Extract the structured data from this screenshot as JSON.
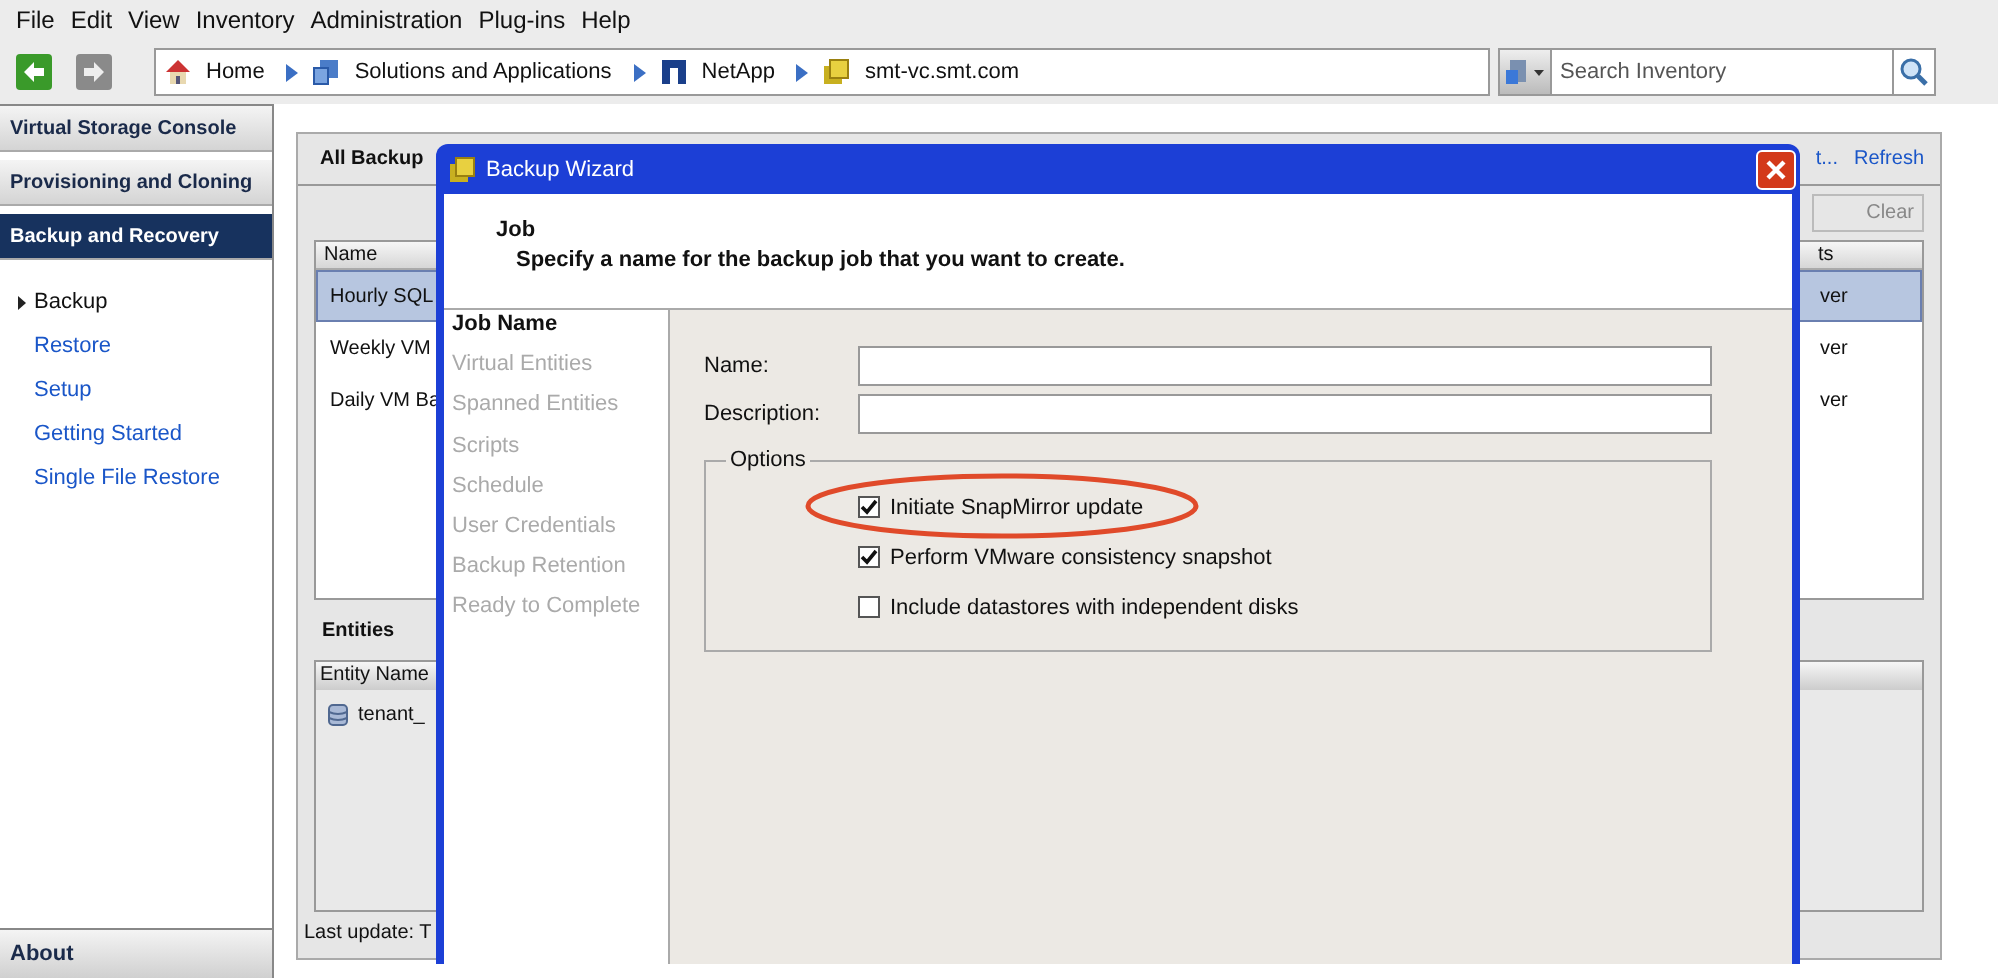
{
  "menu_bar": [
    "File",
    "Edit",
    "View",
    "Inventory",
    "Administration",
    "Plug-ins",
    "Help"
  ],
  "toolbar": {
    "breadcrumbs": [
      {
        "label": "Home"
      },
      {
        "label": "Solutions and Applications"
      },
      {
        "label": "NetApp"
      },
      {
        "label": "smt-vc.smt.com"
      }
    ],
    "search": {
      "placeholder": "Search Inventory"
    }
  },
  "sidebar": {
    "sections": [
      {
        "label": "Virtual Storage Console",
        "selected": false
      },
      {
        "label": "Provisioning and Cloning",
        "selected": false
      },
      {
        "label": "Backup and Recovery",
        "selected": true
      }
    ],
    "items": [
      {
        "label": "Backup",
        "selected": true
      },
      {
        "label": "Restore",
        "selected": false
      },
      {
        "label": "Setup",
        "selected": false
      },
      {
        "label": "Getting Started",
        "selected": false
      },
      {
        "label": "Single File Restore",
        "selected": false
      }
    ],
    "footer": "About"
  },
  "main": {
    "title": "All Backup",
    "links": [
      "t...",
      "Refresh"
    ],
    "clear_button": "Clear",
    "table": {
      "columns": [
        "Name",
        "ts"
      ],
      "rows": [
        {
          "cells": [
            "Hourly SQL",
            "ver"
          ],
          "selected": true
        },
        {
          "cells": [
            "Weekly VM",
            "ver"
          ],
          "selected": false
        },
        {
          "cells": [
            "Daily VM Ba",
            "ver"
          ],
          "selected": false
        }
      ]
    },
    "entities": {
      "title": "Entities",
      "columns": [
        "Entity Name"
      ],
      "rows": [
        "tenant_"
      ]
    },
    "status": "Last update: T"
  },
  "dialog": {
    "title": "Backup Wizard",
    "header_title": "Job",
    "header_subtitle": "Specify a name for the backup job that you want to create.",
    "steps": [
      {
        "label": "Job Name",
        "selected": true
      },
      {
        "label": "Virtual Entities",
        "selected": false
      },
      {
        "label": "Spanned Entities",
        "selected": false
      },
      {
        "label": "Scripts",
        "selected": false
      },
      {
        "label": "Schedule",
        "selected": false
      },
      {
        "label": "User Credentials",
        "selected": false
      },
      {
        "label": "Backup Retention",
        "selected": false
      },
      {
        "label": "Ready to Complete",
        "selected": false
      }
    ],
    "fields": [
      {
        "label": "Name:"
      },
      {
        "label": "Description:"
      }
    ],
    "options": {
      "title": "Options",
      "items": [
        {
          "label": "Initiate SnapMirror update",
          "checked": true,
          "highlighted": true
        },
        {
          "label": "Perform VMware consistency snapshot",
          "checked": true,
          "highlighted": false
        },
        {
          "label": "Include datastores with independent disks",
          "checked": false,
          "highlighted": false
        }
      ]
    }
  }
}
